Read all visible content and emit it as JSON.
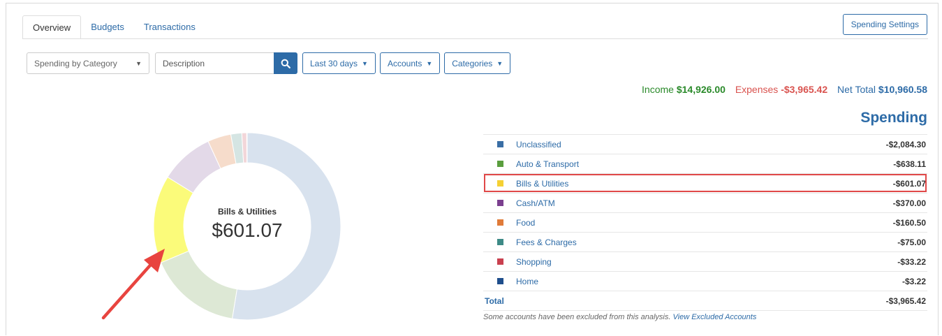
{
  "tabs": [
    "Overview",
    "Budgets",
    "Transactions"
  ],
  "settings_button": "Spending Settings",
  "filters": {
    "view_select": "Spending by Category",
    "description_placeholder": "Description",
    "date_range": "Last 30 days",
    "accounts": "Accounts",
    "categories": "Categories"
  },
  "totals": {
    "income_label": "Income",
    "income_value": "$14,926.00",
    "expenses_label": "Expenses",
    "expenses_value": "-$3,965.42",
    "net_label": "Net Total",
    "net_value": "$10,960.58"
  },
  "spending_title": "Spending",
  "rows": [
    {
      "label": "Unclassified",
      "amount": "-$2,084.30",
      "color": "#3a6ea5"
    },
    {
      "label": "Auto & Transport",
      "amount": "-$638.11",
      "color": "#5a9e3e"
    },
    {
      "label": "Bills & Utilities",
      "amount": "-$601.07",
      "color": "#f5d033"
    },
    {
      "label": "Cash/ATM",
      "amount": "-$370.00",
      "color": "#7b3f8f"
    },
    {
      "label": "Food",
      "amount": "-$160.50",
      "color": "#e07b39"
    },
    {
      "label": "Fees & Charges",
      "amount": "-$75.00",
      "color": "#3d8a86"
    },
    {
      "label": "Shopping",
      "amount": "-$33.22",
      "color": "#c9404f"
    },
    {
      "label": "Home",
      "amount": "-$3.22",
      "color": "#1f4e8c"
    }
  ],
  "total_label": "Total",
  "total_value": "-$3,965.42",
  "note_text": "Some accounts have been excluded from this analysis.",
  "note_link": "View Excluded Accounts",
  "donut_center": {
    "label": "Bills & Utilities",
    "value": "$601.07"
  },
  "chart_data": {
    "type": "pie",
    "categories": [
      "Unclassified",
      "Auto & Transport",
      "Bills & Utilities",
      "Cash/ATM",
      "Food",
      "Fees & Charges",
      "Shopping",
      "Home"
    ],
    "values": [
      2084.3,
      638.11,
      601.07,
      370.0,
      160.5,
      75.0,
      33.22,
      3.22
    ],
    "slice_colors": [
      "#d8e2ee",
      "#dde8d5",
      "#fbfb7a",
      "#e3d9e8",
      "#f6dccb",
      "#d5e5e3",
      "#f2d6d9",
      "#d4dcea"
    ],
    "highlighted": "Bills & Utilities"
  }
}
